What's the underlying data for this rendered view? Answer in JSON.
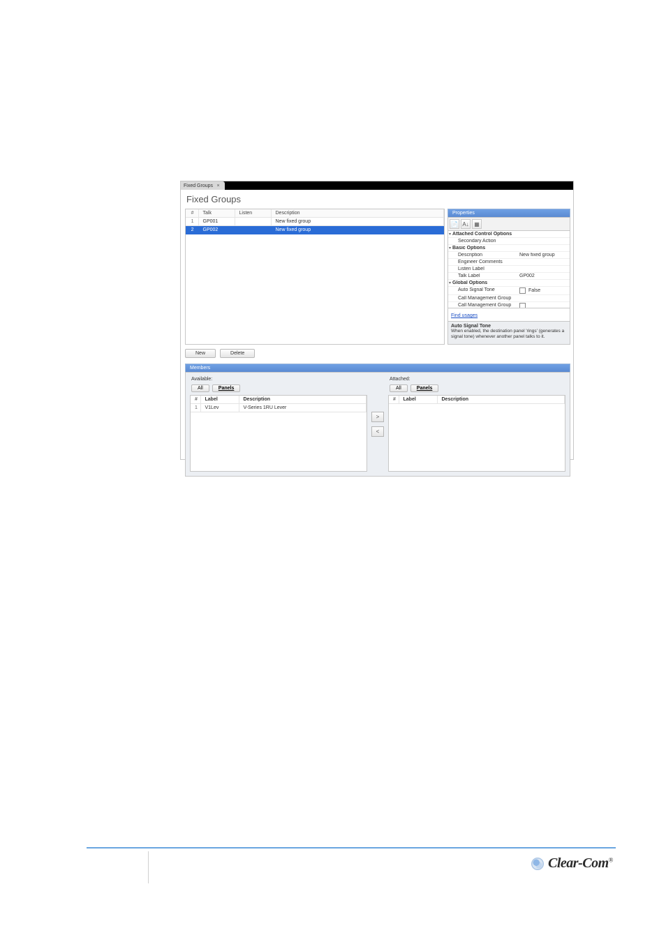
{
  "tab": {
    "label": "Fixed Groups"
  },
  "title": "Fixed Groups",
  "grid": {
    "headers": {
      "num": "#",
      "talk": "Talk",
      "listen": "Listen",
      "desc": "Description"
    },
    "rows": [
      {
        "n": "1",
        "talk": "GP001",
        "listen": "",
        "desc": "New fixed group",
        "selected": false
      },
      {
        "n": "2",
        "talk": "GP002",
        "listen": "",
        "desc": "New fixed group",
        "selected": true
      }
    ]
  },
  "buttons": {
    "new": "New",
    "delete": "Delete"
  },
  "props": {
    "title": "Properties",
    "sections": {
      "attached": "Attached Control Options",
      "basic": "Basic Options",
      "global": "Global Options"
    },
    "items": {
      "secondary_action": "Secondary Action",
      "description_k": "Description",
      "description_v": "New fixed group",
      "eng_comments": "Engineer Comments",
      "listen_label": "Listen Label",
      "talk_label_k": "Talk Label",
      "talk_label_v": "GP002",
      "auto_signal_tone_k": "Auto Signal Tone",
      "auto_signal_tone_v": "False",
      "cmg1": "Call Management Group",
      "cmg2": "Call Management Group"
    },
    "find_usages": "Find usages",
    "help_title": "Auto Signal Tone",
    "help_text": "When enabled, the destination panel 'rings' (generates a signal tone) whenever another panel talks to it."
  },
  "members": {
    "header": "Members",
    "available_label": "Available:",
    "attached_label": "Attached:",
    "filter_all": "All",
    "filter_panels": "Panels",
    "list_headers": {
      "idx": "#",
      "label": "Label",
      "desc": "Description"
    },
    "available_rows": [
      {
        "idx": "1",
        "label": "V1Lev",
        "desc": "V-Series 1RU Lever"
      }
    ],
    "attached_rows": []
  },
  "arrows": {
    "add": ">",
    "remove": "<"
  },
  "footer": {
    "brand": "Clear-Com",
    "reg": "®"
  }
}
